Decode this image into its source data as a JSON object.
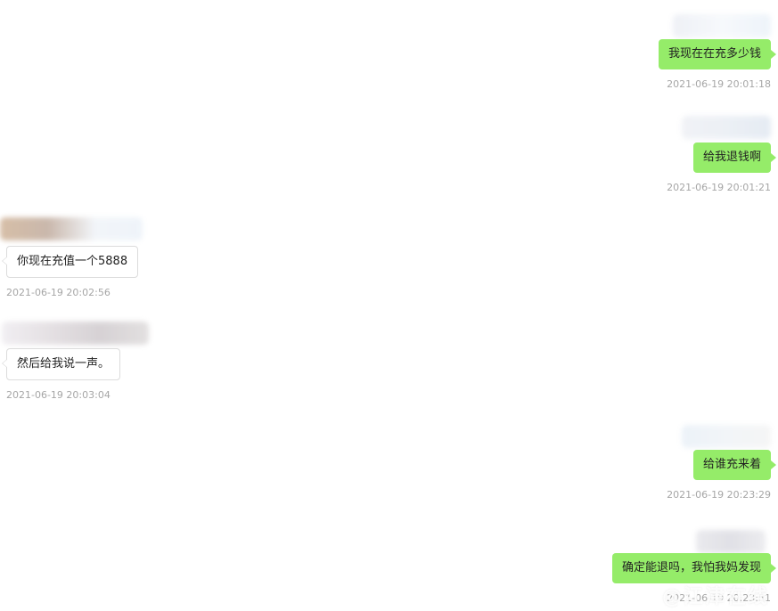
{
  "messages": [
    {
      "side": "right",
      "text": "我现在在充多少钱",
      "time": "2021-06-19 20:01:18"
    },
    {
      "side": "right",
      "text": "给我退钱啊",
      "time": "2021-06-19 20:01:21"
    },
    {
      "side": "left",
      "text": "你现在充值一个5888",
      "time": "2021-06-19 20:02:56"
    },
    {
      "side": "left",
      "text": "然后给我说一声。",
      "time": "2021-06-19 20:03:04"
    },
    {
      "side": "right",
      "text": "给谁充来着",
      "time": "2021-06-19 20:23:29"
    },
    {
      "side": "right",
      "text": "确定能退吗，我怕我妈发现",
      "time": "2021-06-19 20:23:51"
    }
  ],
  "watermark": "@江津在线",
  "colors": {
    "sent_bubble": "#95ec69",
    "received_bubble": "#ffffff",
    "timestamp": "#a6a6a6"
  }
}
